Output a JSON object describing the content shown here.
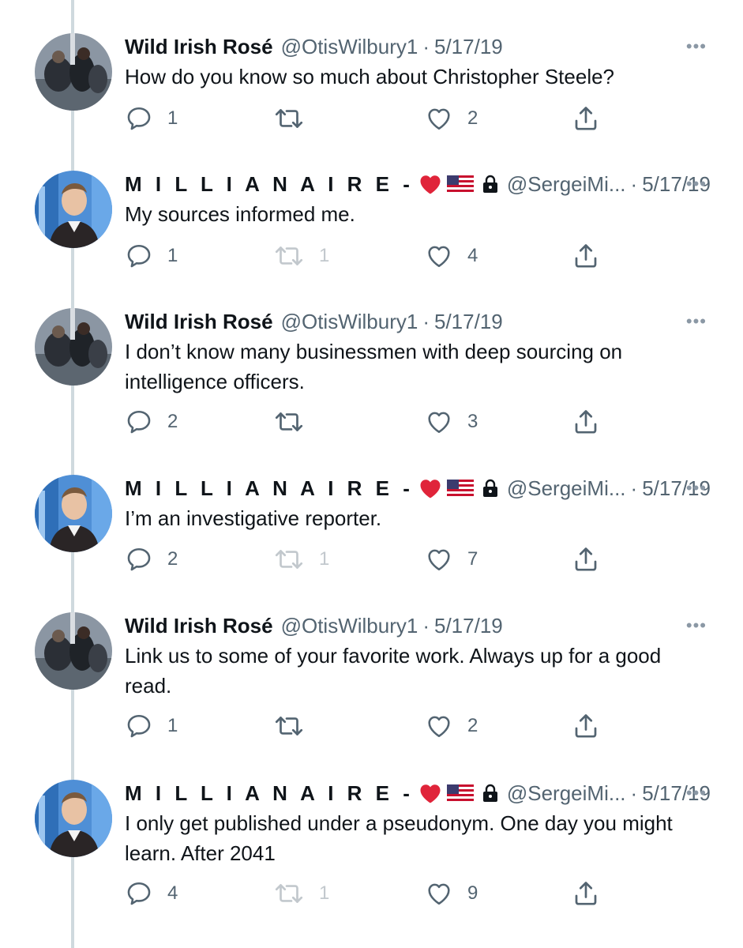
{
  "colors": {
    "text": "#0f1419",
    "secondary": "#536471",
    "thread_line": "#cfd9de",
    "heart_emoji": "#e0243a"
  },
  "tweets": [
    {
      "name": "Wild Irish Rosé",
      "handle": "@OtisWilbury1",
      "separator": "·",
      "date": "5/17/19",
      "text": "How do you know so much about Christopher Steele?",
      "replies": "1",
      "retweets": "",
      "likes": "2",
      "retweet_disabled": false,
      "avatar": "group-photo"
    },
    {
      "name": "M I L L I A N A I R E -",
      "handle": "@SergeiMi...",
      "separator": "·",
      "date": "5/17/19",
      "text": "My sources informed me.",
      "replies": "1",
      "retweets": "1",
      "likes": "4",
      "retweet_disabled": true,
      "avatar": "man-in-suit"
    },
    {
      "name": "Wild Irish Rosé",
      "handle": "@OtisWilbury1",
      "separator": "·",
      "date": "5/17/19",
      "text": "I don’t know many businessmen with deep sourcing on intelligence officers.",
      "replies": "2",
      "retweets": "",
      "likes": "3",
      "retweet_disabled": false,
      "avatar": "group-photo"
    },
    {
      "name": "M I L L I A N A I R E -",
      "handle": "@SergeiMi...",
      "separator": "·",
      "date": "5/17/19",
      "text": "I’m an investigative reporter.",
      "replies": "2",
      "retweets": "1",
      "likes": "7",
      "retweet_disabled": true,
      "avatar": "man-in-suit"
    },
    {
      "name": "Wild Irish Rosé",
      "handle": "@OtisWilbury1",
      "separator": "·",
      "date": "5/17/19",
      "text": "Link us to some of your favorite work. Always up for a good read.",
      "replies": "1",
      "retweets": "",
      "likes": "2",
      "retweet_disabled": false,
      "avatar": "group-photo"
    },
    {
      "name": "M I L L I A N A I R E -",
      "handle": "@SergeiMi...",
      "separator": "·",
      "date": "5/17/19",
      "text": "I only get published under a pseudonym. One day you might learn. After 2041",
      "replies": "4",
      "retweets": "1",
      "likes": "9",
      "retweet_disabled": true,
      "avatar": "man-in-suit"
    }
  ],
  "icons": {
    "reply": "reply-icon",
    "retweet": "retweet-icon",
    "like": "heart-icon",
    "share": "share-icon",
    "more": "more-icon",
    "heart_emoji": "red-heart-emoji",
    "flag_emoji": "us-flag-emoji",
    "lock": "lock-icon"
  }
}
